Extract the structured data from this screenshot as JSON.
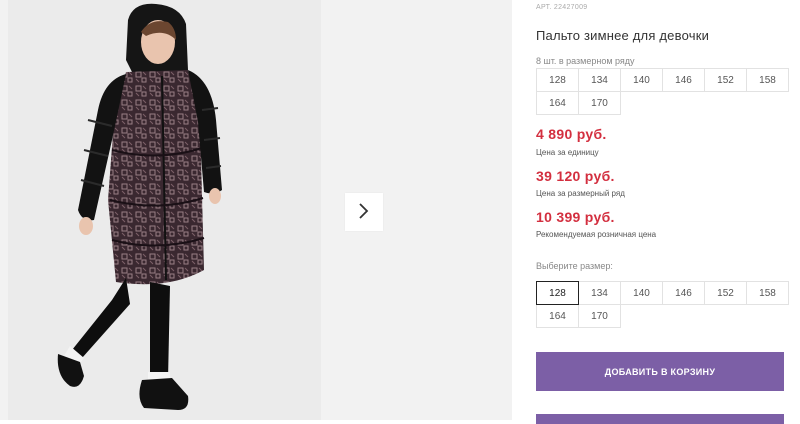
{
  "product": {
    "article": "АРТ. 22427009",
    "title": "Пальто зимнее для девочки"
  },
  "row_sizes": {
    "label": "8 шт. в размерном ряду",
    "sizes": [
      "128",
      "134",
      "140",
      "146",
      "152",
      "158",
      "164",
      "170"
    ]
  },
  "prices": [
    {
      "value": "4 890 руб.",
      "label": "Цена за единицу"
    },
    {
      "value": "39 120 руб.",
      "label": "Цена за размерный ряд"
    },
    {
      "value": "10 399 руб.",
      "label": "Рекомендуемая розничная цена"
    }
  ],
  "size_select": {
    "label": "Выберите размер:",
    "sizes": [
      "128",
      "134",
      "140",
      "146",
      "152",
      "158",
      "164",
      "170"
    ],
    "selected": "128"
  },
  "actions": {
    "add_to_cart": "ДОБАВИТЬ В КОРЗИНУ"
  },
  "colors": {
    "price": "#d32f3f",
    "button": "#7c5fa6"
  },
  "icons": {
    "next": "chevron-right-icon"
  }
}
